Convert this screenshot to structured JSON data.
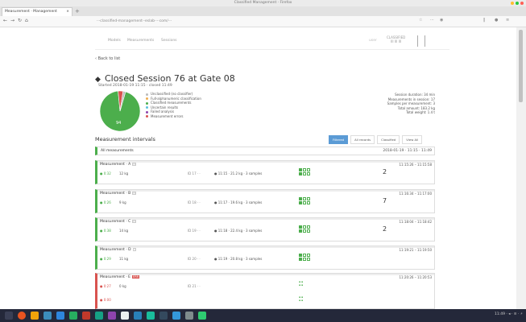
{
  "window": {
    "title": "Classified Management · Firefox",
    "colors": {
      "red": "#ff5f56",
      "yellow": "#ffbd2e",
      "green": "#27c93f"
    }
  },
  "tab": {
    "label": "Measurement · Management",
    "close": "×",
    "new": "+"
  },
  "url": "···classified-management-·eslab····com/···",
  "nav": {
    "back": "←",
    "fwd": "→",
    "reload": "↻",
    "home": "⌂"
  },
  "header": {
    "menu": [
      "Models",
      "Measurements",
      "Sessions"
    ],
    "user": "user",
    "brand_top": "CLASSIFIED",
    "brand_bottom": "III III III"
  },
  "back_link": "‹ Back to list",
  "session": {
    "icon": "◆",
    "title": "Closed Session 76 at Gate 08",
    "subtitle": "Started 2018-01-19 11:15 · closed 11:49"
  },
  "legend": [
    {
      "label": "Unclassified (no classifier)",
      "color": "#bbbbbb"
    },
    {
      "label": "Full-alphanumeric classification",
      "color": "#f0ad4e"
    },
    {
      "label": "Classified measurements",
      "color": "#4cae4c"
    },
    {
      "label": "Uncertain results",
      "color": "#5bc0de"
    },
    {
      "label": "Failed analysis",
      "color": "#8e44ad"
    },
    {
      "label": "Measurement errors",
      "color": "#d9534f"
    }
  ],
  "chart_data": {
    "type": "pie",
    "categories": [
      "Classified",
      "Errors",
      "Unclassified"
    ],
    "values": [
      94,
      4,
      2
    ],
    "colors": [
      "#4cae4c",
      "#d9534f",
      "#bbbbbb"
    ],
    "slice_label": "94"
  },
  "stats": [
    "Session duration: 34 min",
    "Measurements in session: 17",
    "Samples per measurement: 3",
    "Total amount: 183.2 kg",
    "Total weight: 1.4 t"
  ],
  "measurements": {
    "heading": "Measurement intervals",
    "buttons": [
      "Filtered",
      "All records",
      "Classified",
      "View All"
    ],
    "all_label": "All measurements",
    "all_time": "2018-01-19 · 11:15 · 11:49"
  },
  "cards": [
    {
      "name": "Measurement · A",
      "time": "11:15:26 – 11:15:58",
      "status": "● 0:32",
      "status2": "12 kg",
      "id": "ID 17 · ·",
      "info": "● 11:15 · 21.2 kg · 3 samples",
      "count": "2"
    },
    {
      "name": "Measurement · B",
      "time": "11:16:34 – 11:17:00",
      "status": "● 0:26",
      "status2": "9 kg",
      "id": "ID 18 · ·",
      "info": "● 11:17 · 19.6 kg · 3 samples",
      "count": "7"
    },
    {
      "name": "Measurement · C",
      "time": "11:18:04 – 11:18:42",
      "status": "● 0:38",
      "status2": "14 kg",
      "id": "ID 19 · ·",
      "info": "● 11:18 · 22.4 kg · 3 samples",
      "count": "2"
    },
    {
      "name": "Measurement · D",
      "time": "11:19:21 – 11:19:50",
      "status": "● 0:29",
      "status2": "11 kg",
      "id": "ID 20 · ·",
      "info": "● 11:19 · 20.8 kg · 3 samples",
      "count": ""
    }
  ],
  "error_card": {
    "name": "Measurement · E",
    "badge": "ERR",
    "time": "11:20:26 – 11:20:53",
    "status": "● 0:27",
    "status2": "0 kg",
    "id": "ID 21 · ·",
    "sub": "● 0:00"
  },
  "tray": "11:49 · ◂ · ≡ · ⚡"
}
